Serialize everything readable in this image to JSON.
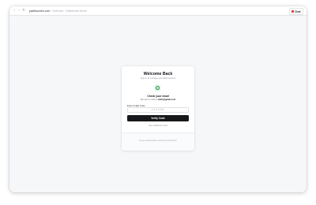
{
  "browser": {
    "url_domain": "pacifica.ems.com",
    "url_separator": "/",
    "url_path": "Overview · Dashboard Home",
    "chat_label": "Chat"
  },
  "auth": {
    "title": "Welcome Back",
    "subtitle": "Sign in to manage your EMS account",
    "check_heading": "Check your email",
    "check_text_prefix": "We sent a code to",
    "check_email": "hello@gmail.com",
    "code_label": "Enter 6-digit Code",
    "code_placeholder": "123456",
    "verify_label": "Verify Code",
    "alt_link": "Use a different email",
    "footer": "Secure authentication powered by OpenAuth"
  },
  "colors": {
    "accent": "#17181b",
    "success": "#2f9a4f",
    "success_bg": "#e5f6ea",
    "chat_dot": "#e0463b"
  }
}
